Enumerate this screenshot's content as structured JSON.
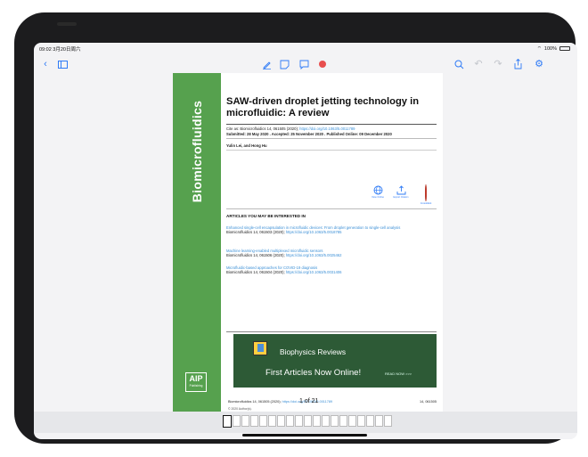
{
  "status_bar": {
    "time": "09:02  3月20日周六",
    "battery": "100%"
  },
  "toolbar": {
    "left_icons": [
      "chevron-left-icon",
      "sidebar-icon"
    ],
    "center_icons": [
      "pen-icon",
      "note-icon",
      "comment-icon",
      "record-icon"
    ],
    "right_icons": [
      "search-icon",
      "undo-icon",
      "redo-icon",
      "share-icon",
      "settings-icon"
    ]
  },
  "page": {
    "journal": "Biomicrofluidics",
    "title": "SAW-driven droplet jetting technology in microfluidic: A review",
    "cite_prefix": "Cite as: Biomicrofluidics 14, 061505 (2020); ",
    "cite_doi": "https://doi.org/10.1063/5.0011789",
    "dates": "Submitted: 28 May 2020 . Accepted: 25 November 2020 . Published Online: 09 December 2020",
    "authors": "Yulin Lei, and Hong Hu",
    "actions": [
      {
        "label": "View Online",
        "icon": "globe-icon"
      },
      {
        "label": "Export Citation",
        "icon": "export-icon"
      },
      {
        "label": "CrossMark",
        "icon": "crossmark-icon"
      }
    ],
    "related_heading": "ARTICLES YOU MAY BE INTERESTED IN",
    "related": [
      {
        "title": "Enhanced single-cell encapsulation in microfluidic devices: From droplet generation to single-cell analysis",
        "journal": "Biomicrofluidics 14, 061503 (2020); ",
        "doi": "https://doi.org/10.1063/5.0018785"
      },
      {
        "title": "Machine learning-enabled multiplexed microfluidic sensors",
        "journal": "Biomicrofluidics 14, 061506 (2020); ",
        "doi": "https://doi.org/10.1063/5.0025462"
      },
      {
        "title": "Microfluidic-based approaches for COVID-19 diagnosis",
        "journal": "Biomicrofluidics 14, 061504 (2020); ",
        "doi": "https://doi.org/10.1063/5.0031406"
      }
    ],
    "banner": {
      "title": "Biophysics Reviews",
      "subtitle": "First Articles Now Online!",
      "cta": "READ NOW >>>"
    },
    "footer": {
      "citation": "Biomicrofluidics 14, 061505 (2020); ",
      "citation_doi": "https://doi.org/10.1063/5.0011789",
      "page_indicator": "1 of 21",
      "volume": "14, 061505",
      "copyright": "© 2020 Author(s)."
    },
    "logo": {
      "big": "AIP",
      "small": "Publishing"
    }
  },
  "thumbnails": {
    "count": 19,
    "active_index": 0
  }
}
